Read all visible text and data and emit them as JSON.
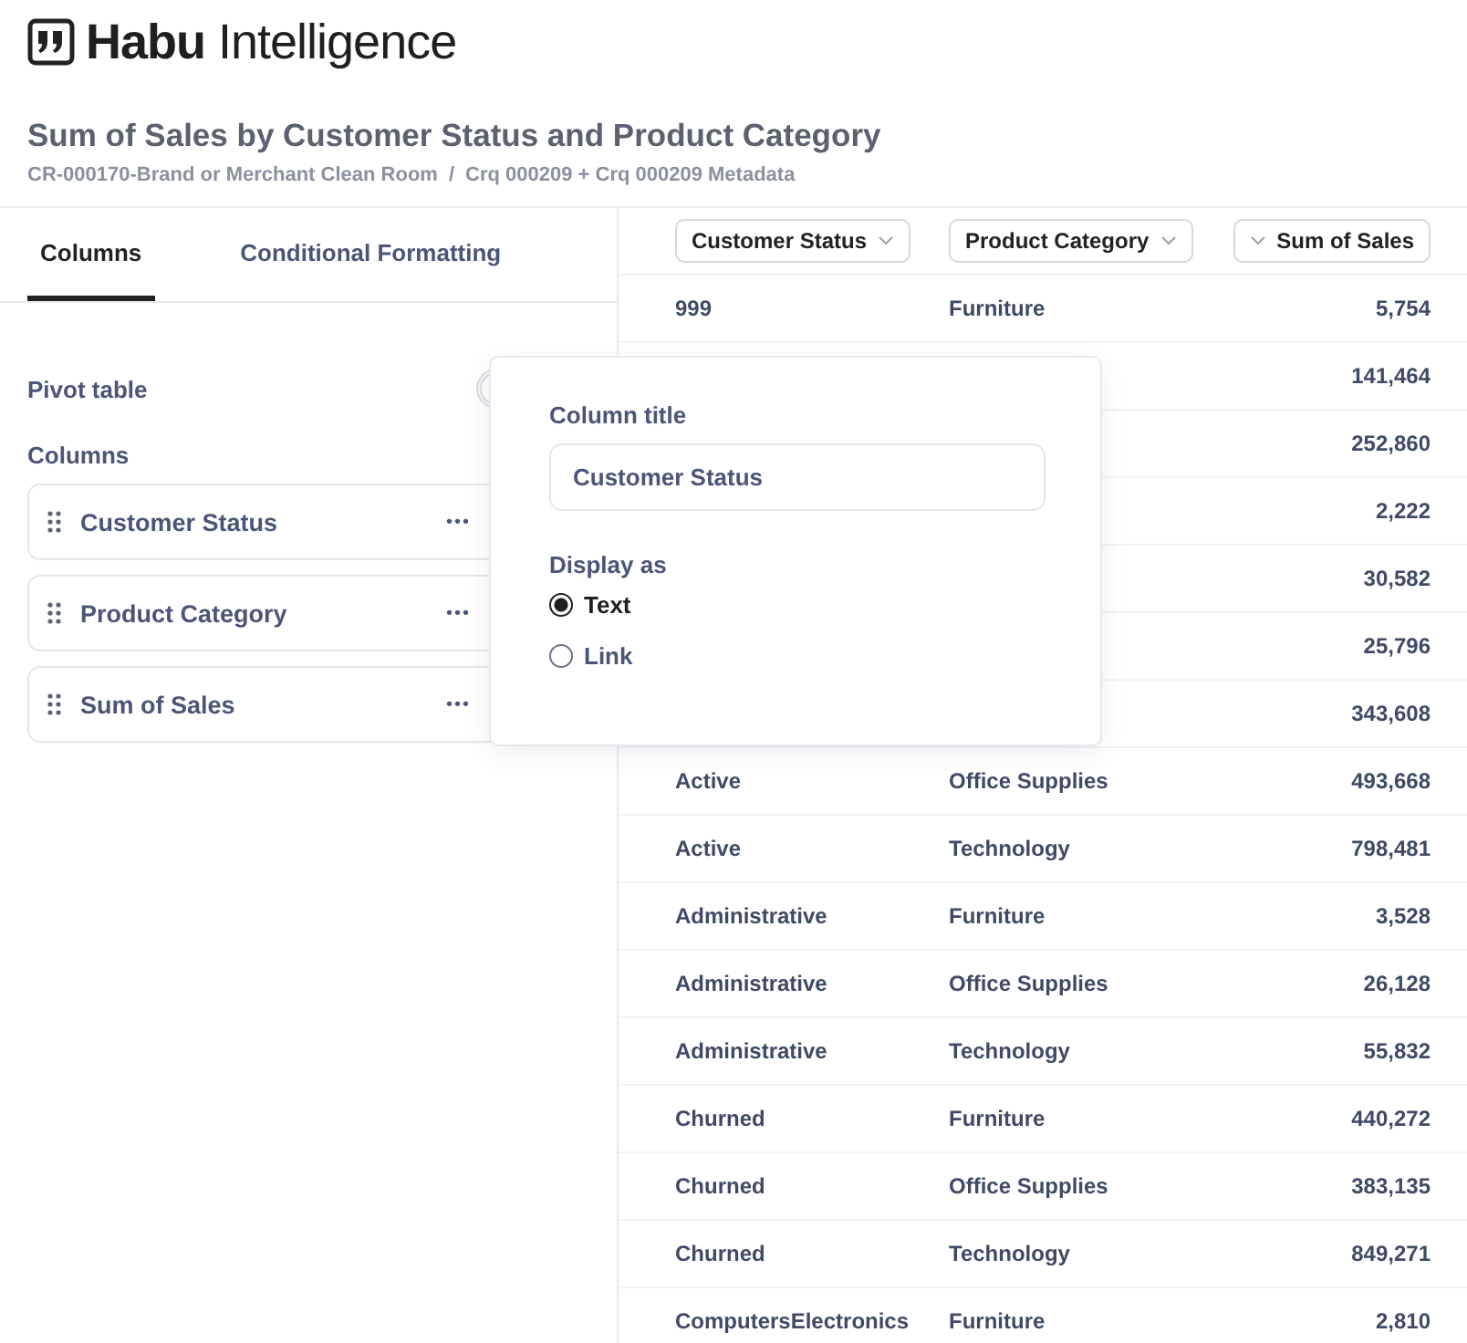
{
  "logo": {
    "text": "**Habu** Intelligence"
  },
  "title": "Sum of Sales by Customer Status and Product Category",
  "breadcrumb": [
    "CR-000170-Brand or Merchant Clean Room",
    "/",
    "Crq 000209 + Crq 000209 Metadata"
  ],
  "tabs": [
    {
      "label": "Columns",
      "selected": true
    },
    {
      "label": "Conditional Formatting",
      "selected": false
    }
  ],
  "pivot_label": "Pivot table",
  "pivot_toggle": {
    "on": false
  },
  "columns_label": "Columns",
  "column_items": [
    {
      "label": "Customer Status",
      "menu": "•••"
    },
    {
      "label": "Product Category",
      "menu": "•••"
    },
    {
      "label": "Sum of Sales",
      "menu": "•••"
    }
  ],
  "popover": {
    "title_label": "Column title",
    "title_value": "Customer Status",
    "display_label": "Display as",
    "options": [
      {
        "label": "Text",
        "selected": true
      },
      {
        "label": "Link",
        "selected": false
      }
    ]
  },
  "table": {
    "columns": [
      {
        "label": "Customer Status",
        "kind": "text"
      },
      {
        "label": "Product Category",
        "kind": "text"
      },
      {
        "label": "Sum of Sales",
        "kind": "number"
      }
    ],
    "rows": [
      {
        "status": "999",
        "category": "Furniture",
        "sales": "5,754"
      },
      {
        "sales": "141,464"
      },
      {
        "sales": "252,860"
      },
      {
        "sales": "2,222"
      },
      {
        "sales": "30,582"
      },
      {
        "sales": "25,796"
      },
      {
        "sales": "343,608"
      },
      {
        "status": "Active",
        "category": "Office Supplies",
        "sales": "493,668"
      },
      {
        "status": "Active",
        "category": "Technology",
        "sales": "798,481"
      },
      {
        "status": "Administrative",
        "category": "Furniture",
        "sales": "3,528"
      },
      {
        "status": "Administrative",
        "category": "Office Supplies",
        "sales": "26,128"
      },
      {
        "status": "Administrative",
        "category": "Technology",
        "sales": "55,832"
      },
      {
        "status": "Churned",
        "category": "Furniture",
        "sales": "440,272"
      },
      {
        "status": "Churned",
        "category": "Office Supplies",
        "sales": "383,135"
      },
      {
        "status": "Churned",
        "category": "Technology",
        "sales": "849,271"
      },
      {
        "status": "ComputersElectronics",
        "category": "Furniture",
        "sales": "2,810"
      }
    ]
  }
}
